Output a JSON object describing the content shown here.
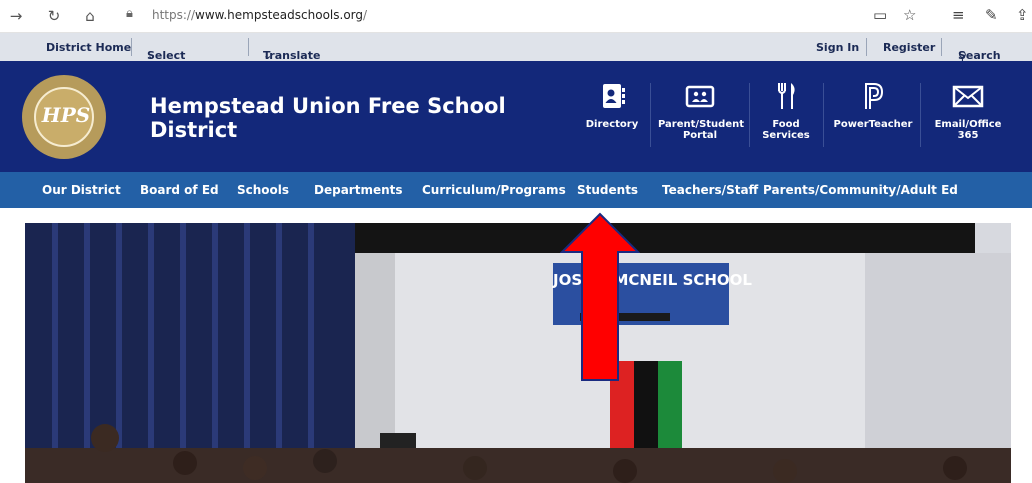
{
  "browser": {
    "url_prefix": "https://",
    "url_domain": "www.hempsteadschools.org",
    "url_suffix": "/"
  },
  "utility": {
    "district_home": "District Home",
    "select_school": "Select a School",
    "translate": "Translate",
    "sign_in": "Sign In",
    "register": "Register",
    "search": "Search"
  },
  "header": {
    "title": "Hempstead Union Free School District",
    "logo_text": "HPS"
  },
  "quicklinks": [
    {
      "label": "Directory"
    },
    {
      "label": "Parent/Student Portal"
    },
    {
      "label": "Food Services"
    },
    {
      "label": "PowerTeacher"
    },
    {
      "label": "Email/Office 365"
    }
  ],
  "nav": {
    "items": [
      "Our District",
      "Board of Ed",
      "Schools",
      "Departments",
      "Curriculum/Programs",
      "Students",
      "Teachers/Staff",
      "Parents/Community/Adult Ed"
    ]
  },
  "banner": {
    "sign": "JOS      MCNEIL SCHOOL"
  },
  "colors": {
    "header_bg": "#13287a",
    "nav_bg": "#2360a6",
    "util_bg": "#dfe3ea",
    "annotation_arrow": "#ff0000"
  }
}
